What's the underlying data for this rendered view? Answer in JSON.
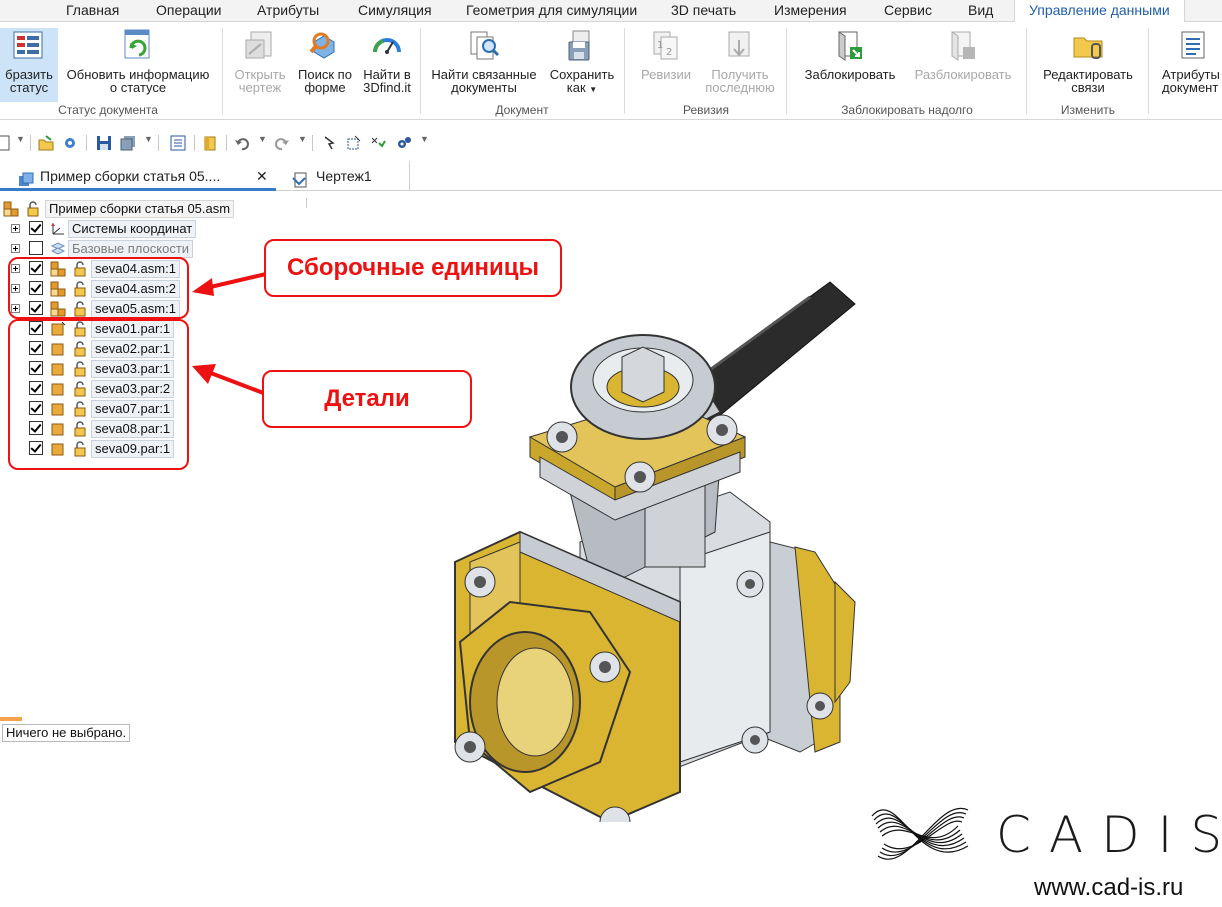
{
  "menu": {
    "tabs": [
      "Главная",
      "Операции",
      "Атрибуты",
      "Симуляция",
      "Геометрия для симуляции",
      "3D печать",
      "Измерения",
      "Сервис",
      "Вид",
      "Управление данными"
    ],
    "active": "Управление данными"
  },
  "ribbon": {
    "buttons": {
      "show_status": [
        "бразить",
        "статус"
      ],
      "update_status": [
        "Обновить информацию",
        "о статусе"
      ],
      "open_drawing": [
        "Открыть",
        "чертеж"
      ],
      "shape_search": [
        "Поиск по",
        "форме"
      ],
      "find_3dfind": [
        "Найти в",
        "3Dfind.it"
      ],
      "find_related": [
        "Найти связанные",
        "документы"
      ],
      "save_as": [
        "Сохранить",
        "как"
      ],
      "revisions": [
        "Ревизии"
      ],
      "get_latest": [
        "Получить",
        "последнюю"
      ],
      "lock": [
        "Заблокировать"
      ],
      "unlock": [
        "Разблокировать"
      ],
      "edit_links": [
        "Редактировать",
        "связи"
      ],
      "doc_attrs": [
        "Атрибуты",
        "документ"
      ]
    },
    "groups": {
      "doc_status": "Статус документа",
      "document": "Документ",
      "revision": "Ревизия",
      "lock": "Заблокировать надолго",
      "change": "Изменить"
    }
  },
  "doc_tabs": {
    "assembly": "Пример сборки статья 05....",
    "drawing": "Чертеж1",
    "close_glyph": "✕"
  },
  "tree": {
    "root": "Пример сборки статья 05.asm",
    "coord_systems": "Системы координат",
    "base_planes": "Базовые плоскости",
    "assemblies": [
      "seva04.asm:1",
      "seva04.asm:2",
      "seva05.asm:1"
    ],
    "parts": [
      "seva01.par:1",
      "seva02.par:1",
      "seva03.par:1",
      "seva03.par:2",
      "seva07.par:1",
      "seva08.par:1",
      "seva09.par:1"
    ]
  },
  "annotations": {
    "assemblies_label": "Сборочные единицы",
    "parts_label": "Детали",
    "color": "#e11111"
  },
  "status": "Ничего не выбрано.",
  "logo": {
    "word": "CADIS",
    "url": "www.cad-is.ru"
  },
  "colors": {
    "accent": "#1f5fa8",
    "brass": "#d9b531",
    "steel": "#cfd3d8",
    "handle": "#2b2b2b"
  }
}
